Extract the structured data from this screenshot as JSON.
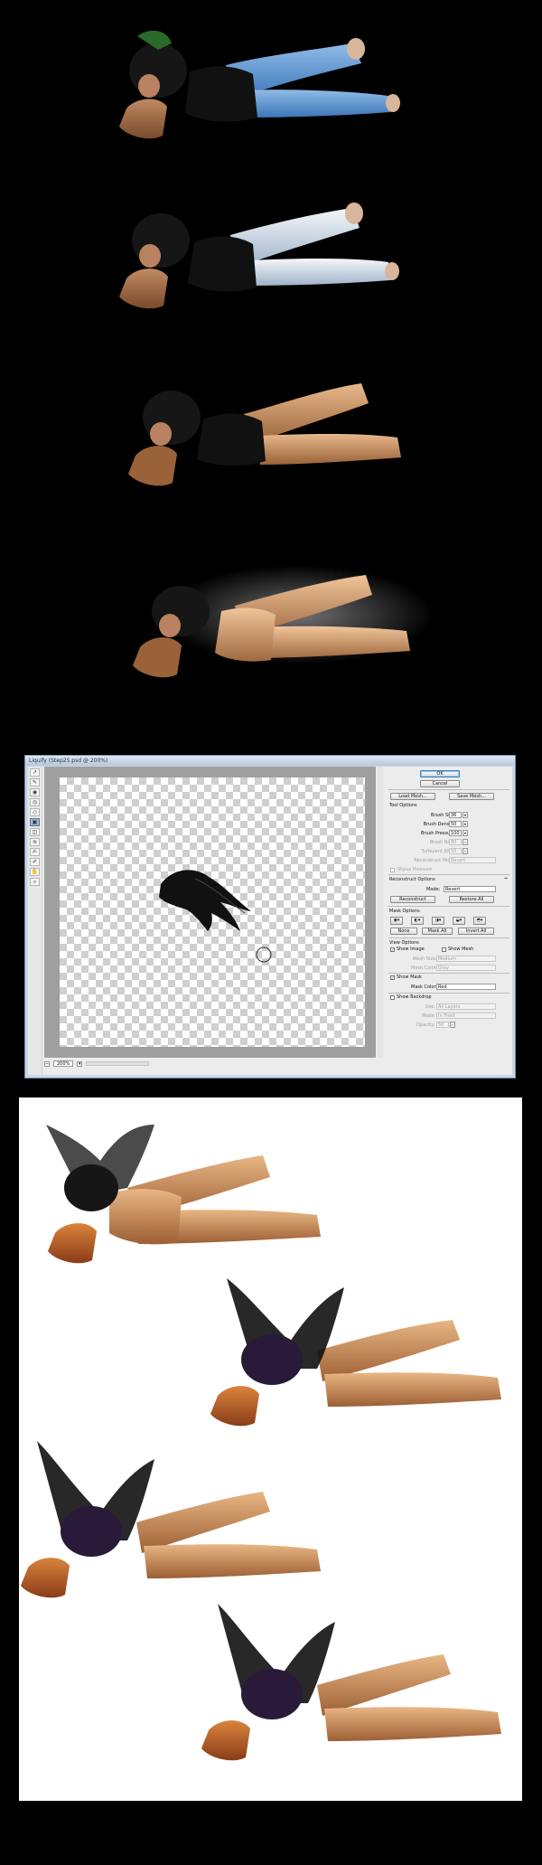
{
  "liquify": {
    "title": "Liquify (Step25.psd @ 200%)",
    "buttons": {
      "ok": "OK",
      "cancel": "Cancel",
      "load_mesh": "Load Mesh...",
      "save_mesh": "Save Mesh...",
      "reconstruct": "Reconstruct",
      "restore_all": "Restore All",
      "none": "None",
      "mask_all": "Mask All",
      "invert_all": "Invert All"
    },
    "tool_options": {
      "heading": "Tool Options",
      "brush_size_label": "Brush Size:",
      "brush_size": "36",
      "brush_density_label": "Brush Density:",
      "brush_density": "50",
      "brush_pressure_label": "Brush Pressure:",
      "brush_pressure": "100",
      "brush_rate_label": "Brush Rate:",
      "brush_rate": "80",
      "turbulent_jitter_label": "Turbulent Jitter:",
      "turbulent_jitter": "50",
      "reconstruct_mode_label": "Reconstruct Mode:",
      "reconstruct_mode": "Revert",
      "stylus_pressure": "Stylus Pressure"
    },
    "reconstruct_options": {
      "heading": "Reconstruct Options",
      "mode_label": "Mode:",
      "mode": "Revert"
    },
    "mask_options": {
      "heading": "Mask Options"
    },
    "view_options": {
      "heading": "View Options",
      "show_image": "Show Image",
      "show_mesh": "Show Mesh",
      "mesh_size_label": "Mesh Size:",
      "mesh_size": "Medium",
      "mesh_color_label": "Mesh Color:",
      "mesh_color": "Gray",
      "show_mask": "Show Mask",
      "mask_color_label": "Mask Color:",
      "mask_color": "Red",
      "show_backdrop": "Show Backdrop",
      "use_label": "Use:",
      "use": "All Layers",
      "mode_label": "Mode:",
      "mode": "In Front",
      "opacity_label": "Opacity:",
      "opacity": "50"
    },
    "status": {
      "zoom": "200%"
    }
  },
  "colors": {
    "page_bg": "#000000",
    "window_chrome": "#c9d7e6",
    "checker": "#cfcfcf",
    "composite_bg": "#ffffff"
  }
}
